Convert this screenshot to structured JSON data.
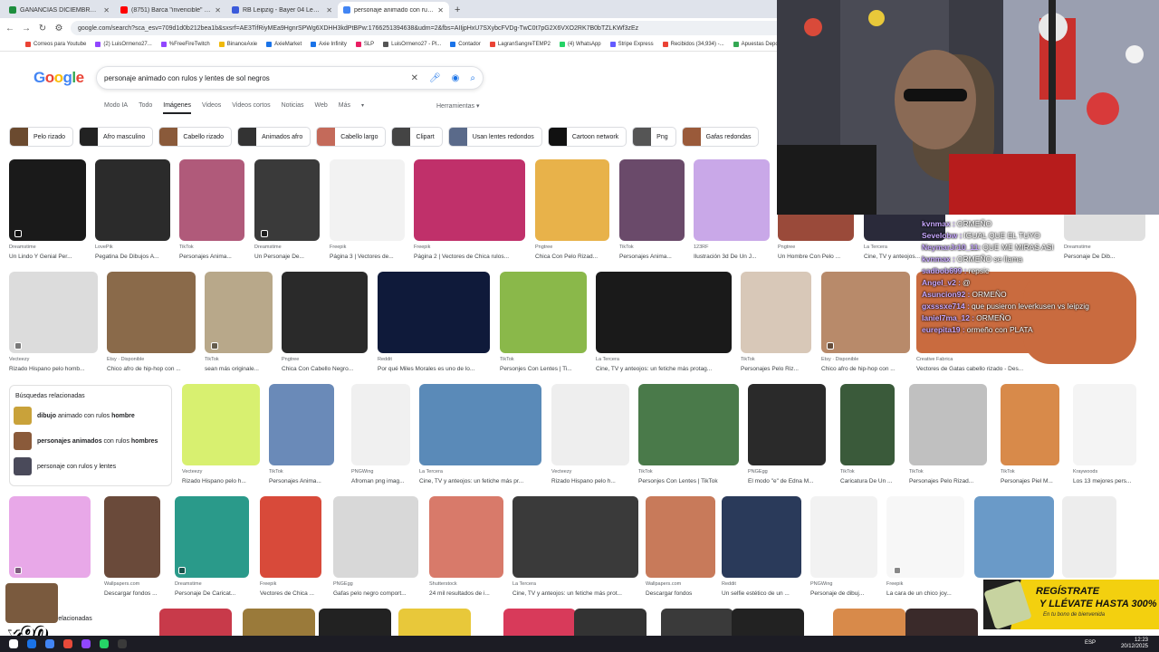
{
  "tabs": [
    {
      "title": "GANANCIAS DICIEMBRE - Hoja",
      "color": "#1e8e3e"
    },
    {
      "title": "(8751) Barca \"invencible\" en Vill",
      "color": "#ff0000"
    },
    {
      "title": "RB Leipzig - Bayer 04 Leverkus",
      "color": "#3b5bdb"
    },
    {
      "title": "personaje animado con rulos y",
      "color": "#4285f4"
    }
  ],
  "url": "google.com/search?sca_esv=709d1d0b212bea1b&sxsrf=AE3TifRiyMEa9HgnrSPWg6XDHH3kdPtBPw:1766251394638&udm=2&fbs=AIIjpHxU7SXybcFVDg-TwC0t7pG2X6VXO2RK7B0bTZLKWf3zEz",
  "bookmarks": [
    {
      "label": "Correos para Youtube",
      "color": "#ea4335"
    },
    {
      "label": "(2) LuisOrmeno27...",
      "color": "#9146ff"
    },
    {
      "label": "%FreeFireTwitch",
      "color": "#9146ff"
    },
    {
      "label": "BinanceAxie",
      "color": "#f0b90b"
    },
    {
      "label": "AxieMarket",
      "color": "#1a73e8"
    },
    {
      "label": "Axie Infinity",
      "color": "#1a73e8"
    },
    {
      "label": "SLP",
      "color": "#e91e63"
    },
    {
      "label": "LuisOrmeno27 - Pl...",
      "color": "#555555"
    },
    {
      "label": "Contador",
      "color": "#1a73e8"
    },
    {
      "label": "LagranSangreTEMP2",
      "color": "#ea4335"
    },
    {
      "label": "(4) WhatsApp",
      "color": "#25d366"
    },
    {
      "label": "Stripe Express",
      "color": "#635bff"
    },
    {
      "label": "Recibidos (34,934) -...",
      "color": "#ea4335"
    },
    {
      "label": "Apuestas Depor...",
      "color": "#34a853"
    }
  ],
  "logo": {
    "letters": [
      "G",
      "o",
      "o",
      "g",
      "l",
      "e"
    ],
    "colors": [
      "#4285f4",
      "#ea4335",
      "#fbbc05",
      "#4285f4",
      "#34a853",
      "#ea4335"
    ]
  },
  "search": {
    "query": "personaje animado con rulos y lentes de sol negros"
  },
  "nav_tabs": [
    "Modo IA",
    "Todo",
    "Imágenes",
    "Videos",
    "Videos cortos",
    "Noticias",
    "Web",
    "Más"
  ],
  "nav_active": "Imágenes",
  "tools": "Herramientas",
  "chips": [
    {
      "label": "Pelo rizado",
      "color": "#6b4a2f"
    },
    {
      "label": "Afro masculino",
      "color": "#222222"
    },
    {
      "label": "Cabello rizado",
      "color": "#8a5a3a"
    },
    {
      "label": "Animados afro",
      "color": "#333333"
    },
    {
      "label": "Cabello largo",
      "color": "#c46a5a"
    },
    {
      "label": "Clipart",
      "color": "#444444"
    },
    {
      "label": "Usan lentes redondos",
      "color": "#5a6a8a"
    },
    {
      "label": "Cartoon network",
      "color": "#111111"
    },
    {
      "label": "Png",
      "color": "#555555"
    },
    {
      "label": "Gafas redondas",
      "color": "#9a5a3a"
    }
  ],
  "row1": [
    {
      "source": "Dreamstime",
      "caption": "Un Lindo Y Genial Per...",
      "color": "#1a1a1a"
    },
    {
      "source": "LovePik",
      "caption": "Pegatina De Dibujos A...",
      "color": "#2b2b2b"
    },
    {
      "source": "TikTok",
      "caption": "Personajes Anima...",
      "color": "#b05a7a"
    },
    {
      "source": "Dreamstime",
      "caption": "Un Personaje De...",
      "color": "#3a3a3a"
    },
    {
      "source": "Freepik",
      "caption": "Página 3 | Vectores de...",
      "color": "#f2f2f2"
    },
    {
      "source": "Freepik",
      "caption": "Página 2 | Vectores de Chica rulos...",
      "color": "#c0306a"
    },
    {
      "source": "Pngtree",
      "caption": "Chica Con Pelo Rizad...",
      "color": "#e8b24a"
    },
    {
      "source": "TikTok",
      "caption": "Personajes Anima...",
      "color": "#6a4a6a"
    },
    {
      "source": "123RF",
      "caption": "Ilustración 3d De Un J...",
      "color": "#c9a8e8"
    },
    {
      "source": "Pngtree",
      "caption": "Un Hombre Con Pelo ...",
      "color": "#9a4a3a"
    },
    {
      "source": "La Tercera",
      "caption": "Cine, TV y anteojos...",
      "color": "#2a2a3a"
    },
    {
      "source": "Dreamstime",
      "caption": "Personaje De Dib...",
      "color": "#e0e0e0"
    }
  ],
  "row2": [
    {
      "source": "Vecteezy",
      "caption": "Rizado Hispano pelo homb...",
      "color": "#dcdcdc"
    },
    {
      "source": "Etsy · Disponible",
      "caption": "Chico afro de hip-hop con ...",
      "color": "#8a6a4a"
    },
    {
      "source": "TikTok",
      "caption": "sean más originale...",
      "color": "#b8a88a"
    },
    {
      "source": "Pngtree",
      "caption": "Chica Con Cabello Negro...",
      "color": "#2a2a2a"
    },
    {
      "source": "Reddit",
      "caption": "Por qué Miles Morales es uno de lo...",
      "color": "#0f1a3a"
    },
    {
      "source": "TikTok",
      "caption": "Personjes Con Lentes | Ti...",
      "color": "#8ab84a"
    },
    {
      "source": "La Tercera",
      "caption": "Cine, TV y anteojos: un fetiche más protag...",
      "color": "#1a1a1a"
    },
    {
      "source": "TikTok",
      "caption": "Personajes Pelo Riz...",
      "color": "#d8c8b8"
    },
    {
      "source": "Etsy · Disponible",
      "caption": "Chico afro de hip-hop con ...",
      "color": "#b88a6a"
    },
    {
      "source": "Creative Fabrica",
      "caption": "Vectores de Gatas cabello rizado - Des...",
      "color": "#c96b3f"
    }
  ],
  "related": {
    "title": "Búsquedas relacionadas",
    "items": [
      {
        "pre": "dibujo",
        "mid": " animado con rulos ",
        "post": "hombre",
        "color": "#c9a23a"
      },
      {
        "pre": "personajes animados",
        "mid": " con rulos ",
        "post": "hombres",
        "color": "#8a5a3a"
      },
      {
        "pre": "",
        "mid": "personaje con rulos y lentes",
        "post": "",
        "color": "#4a4a5a"
      }
    ]
  },
  "row3": [
    {
      "source": "Vecteezy",
      "caption": "Rizado Hispano pelo h...",
      "color": "#d8f070"
    },
    {
      "source": "TikTok",
      "caption": "Personajes Anima...",
      "color": "#6a8ab8"
    },
    {
      "source": "PNGWing",
      "caption": "Afroman png imag...",
      "color": "#f0f0f0"
    },
    {
      "source": "La Tercera",
      "caption": "Cine, TV y anteojos: un fetiche más pr...",
      "color": "#5a8ab8"
    },
    {
      "source": "Vecteezy",
      "caption": "Rizado Hispano pelo h...",
      "color": "#eeeeee"
    },
    {
      "source": "TikTok",
      "caption": "Personjes Con Lentes | TikTok",
      "color": "#4a7a4a"
    },
    {
      "source": "PNGEgg",
      "caption": "El modo \"e\" de Edna M...",
      "color": "#2a2a2a"
    },
    {
      "source": "TikTok",
      "caption": "Caricatura De Un ...",
      "color": "#3a5a3a"
    },
    {
      "source": "TikTok",
      "caption": "Personajes Pelo Rizad...",
      "color": "#c0c0c0"
    },
    {
      "source": "TikTok",
      "caption": "Personajes Piel M...",
      "color": "#d88a4a"
    },
    {
      "source": "Kraywoods",
      "caption": "Los 13 mejores pers...",
      "color": "#f4f4f4"
    }
  ],
  "row4": [
    {
      "source": "",
      "caption": "ne de...",
      "color": "#e8a8e8"
    },
    {
      "source": "Wallpapers.com",
      "caption": "Descargar fondos ...",
      "color": "#6a4a3a"
    },
    {
      "source": "Dreamstime",
      "caption": "Personaje De Caricat...",
      "color": "#2a9a8a"
    },
    {
      "source": "Freepik",
      "caption": "Vectores de Chica ...",
      "color": "#d84a3a"
    },
    {
      "source": "PNGEgg",
      "caption": "Gafas pelo negro comport...",
      "color": "#d8d8d8"
    },
    {
      "source": "Shutterstock",
      "caption": "24 mil resultados de i...",
      "color": "#d87a6a"
    },
    {
      "source": "La Tercera",
      "caption": "Cine, TV y anteojos: un fetiche más prot...",
      "color": "#3a3a3a"
    },
    {
      "source": "Wallpapers.com",
      "caption": "Descargar fondos",
      "color": "#c87a5a"
    },
    {
      "source": "Reddit",
      "caption": "Un selfie estético de un ...",
      "color": "#2a3a5a"
    },
    {
      "source": "PNGWing",
      "caption": "Personaje de dibuj...",
      "color": "#f2f2f2"
    },
    {
      "source": "Freepik",
      "caption": "La cara de un chico joy...",
      "color": "#f7f7f7"
    },
    {
      "source": "",
      "caption": "",
      "color": "#6a9ac8"
    },
    {
      "source": "",
      "caption": "",
      "color": "#ededed"
    }
  ],
  "row5_colors": [
    "#c83a4a",
    "#9a7a3a",
    "#222222",
    "#e8c83a",
    "#d83a5a",
    "#333333",
    "#3a3a3a",
    "#222222",
    "#d88a4a",
    "#3a2a2a"
  ],
  "related_bottom": "relacionadas",
  "chat": [
    {
      "user": "kvnmax :",
      "text": "ORMEÑO"
    },
    {
      "user": "Sevelobw :",
      "text": "IGUAL QUE EL TUYO"
    },
    {
      "user": "NeymarJr10_11:",
      "text": "QUE ME MIRAS ASI"
    },
    {
      "user": "kvnmax :",
      "text": "ORMEÑO se llama"
    },
    {
      "user": "sadbob699 :",
      "text": "repsic"
    },
    {
      "user": "Angel_v2 :",
      "text": "@"
    },
    {
      "user": "Asuncion92 :",
      "text": "ORMEÑO"
    },
    {
      "user": "gxsssxe714 :",
      "text": "que pusieron leverkusen vs leipzig"
    },
    {
      "user": "Ianiel7ma_12 :",
      "text": "ORMEÑO"
    },
    {
      "user": "eurepita19 :",
      "text": "ormeño con PLATA"
    }
  ],
  "promo": {
    "line1": "REGÍSTRATE",
    "line2": "Y LLÉVATE HASTA 300%",
    "line3": "En tu bono de bienvenida"
  },
  "overlay_badge": "x90",
  "taskbar": {
    "lang": "ESP",
    "time": "12:23",
    "date": "20/12/2025",
    "apps": [
      "#ffffff",
      "#1a73e8",
      "#4285f4",
      "#e84a3a",
      "#9146ff",
      "#25d366",
      "#3a3a3a"
    ]
  }
}
